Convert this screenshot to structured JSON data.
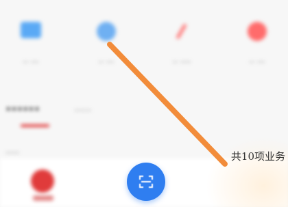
{
  "quick_actions": [
    {
      "icon": "card-icon",
      "label": "·· ···"
    },
    {
      "icon": "circle-icon",
      "label": "·· ···"
    },
    {
      "icon": "pen-icon",
      "label": "·· ····"
    },
    {
      "icon": "red-circle-icon",
      "label": "·· ···"
    }
  ],
  "section": {
    "title": "······",
    "subtitle": "·····"
  },
  "list_item": "····",
  "total_text": "共10项业务",
  "bottom_nav": {
    "scan_icon": "scan-icon",
    "home_icon": "home-icon"
  },
  "colors": {
    "accent_blue": "#2f7ef0",
    "accent_red": "#e03b3b",
    "annotation_orange": "#f28c3a"
  }
}
